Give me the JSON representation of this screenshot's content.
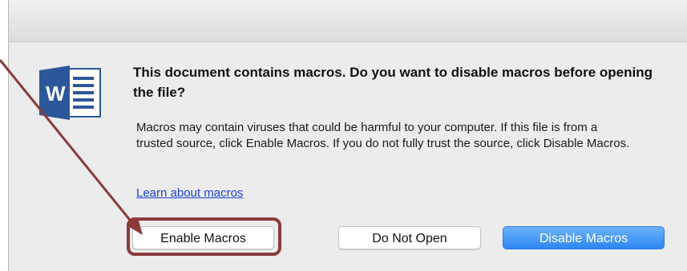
{
  "dialog": {
    "heading": "This document contains macros. Do you want to disable macros before opening the file?",
    "message": "Macros may contain viruses that could be harmful to your computer.  If this file is from a trusted source, click Enable Macros. If you do not fully trust the source, click Disable Macros.",
    "link_label": "Learn about macros",
    "app_icon": "word-icon",
    "app_icon_letter": "W"
  },
  "buttons": {
    "enable_label": "Enable Macros",
    "do_not_open_label": "Do Not Open",
    "disable_label": "Disable Macros"
  },
  "annotation": {
    "color": "#8b3a3a"
  },
  "colors": {
    "word_blue": "#2b579a",
    "primary_button": "#2d86f2",
    "link": "#1a3fe0"
  }
}
